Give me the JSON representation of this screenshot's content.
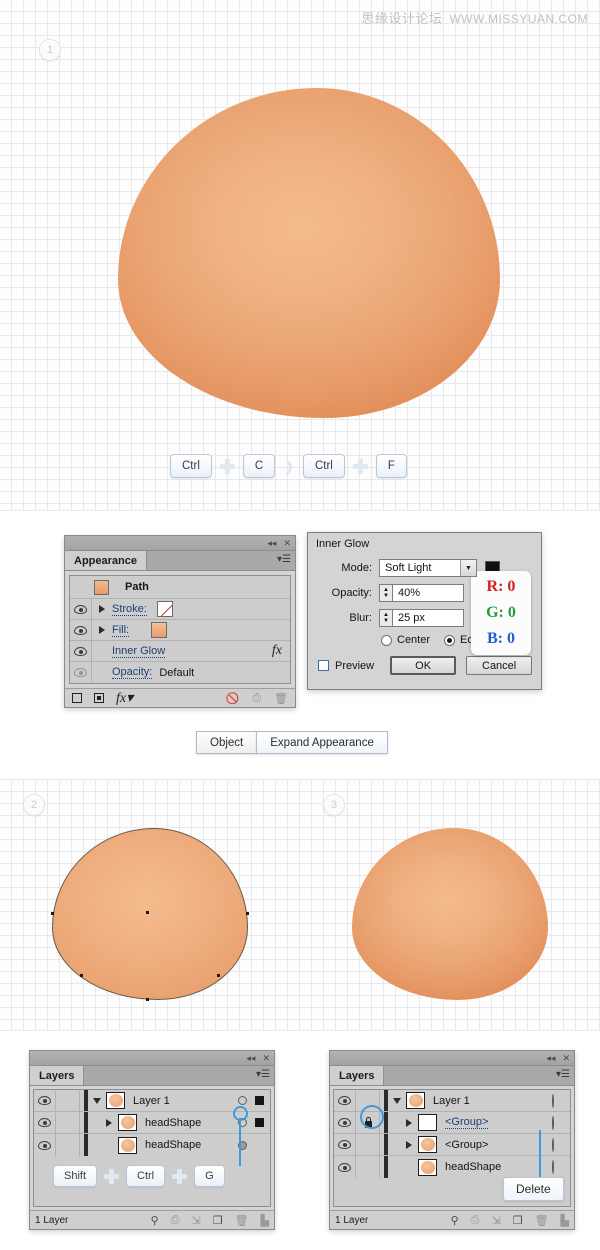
{
  "watermark": {
    "cn": "思缘设计论坛",
    "url": "WWW.MISSYUAN.COM"
  },
  "steps": {
    "one": "1",
    "two": "2",
    "three": "3"
  },
  "shortcut_top": {
    "keys": [
      "Ctrl",
      "C",
      "Ctrl",
      "F"
    ],
    "separator": "❯"
  },
  "appearance_panel": {
    "tab": "Appearance",
    "rows": [
      {
        "label": "Path",
        "type": "header"
      },
      {
        "label": "Stroke:",
        "type": "stroke"
      },
      {
        "label": "Fill:",
        "type": "fill"
      },
      {
        "label": "Inner Glow",
        "type": "effect",
        "fx": "fx"
      },
      {
        "label": "Opacity:",
        "value": "Default",
        "type": "opacity"
      }
    ]
  },
  "inner_glow_dialog": {
    "title": "Inner Glow",
    "mode_label": "Mode:",
    "mode_value": "Soft Light",
    "color": "#111111",
    "opacity_label": "Opacity:",
    "opacity_value": "40%",
    "blur_label": "Blur:",
    "blur_value": "25 px",
    "radio_center": "Center",
    "radio_edge": "Edge",
    "selected_radio": "Edge",
    "preview_label": "Preview",
    "ok_label": "OK",
    "cancel_label": "Cancel",
    "rgb_card": {
      "r": "R: 0",
      "g": "G: 0",
      "b": "B: 0"
    }
  },
  "menu_buttons": {
    "object": "Object",
    "expand_appearance": "Expand Appearance"
  },
  "layers_panel_left": {
    "tab": "Layers",
    "rows": [
      {
        "label": "Layer 1",
        "indent": 0,
        "arrow": "down"
      },
      {
        "label": "headShape",
        "indent": 1,
        "arrow": "right"
      },
      {
        "label": "headShape",
        "indent": 1,
        "arrow": "none"
      }
    ],
    "footer": "1 Layer",
    "shortcut": [
      "Shift",
      "Ctrl",
      "G"
    ]
  },
  "layers_panel_right": {
    "tab": "Layers",
    "rows": [
      {
        "label": "Layer 1",
        "indent": 0,
        "arrow": "down"
      },
      {
        "label": "<Group>",
        "indent": 1,
        "arrow": "right"
      },
      {
        "label": "<Group>",
        "indent": 1,
        "arrow": "right"
      },
      {
        "label": "headShape",
        "indent": 1,
        "arrow": "none"
      }
    ],
    "footer": "1 Layer",
    "callout": "Delete"
  },
  "colors": {
    "egg_light": "#f3bb8b",
    "egg_mid": "#eba776",
    "egg_dark": "#e3915c",
    "highlight_blue": "#3d9bdd",
    "panel_gray": "#d4d4d4"
  }
}
